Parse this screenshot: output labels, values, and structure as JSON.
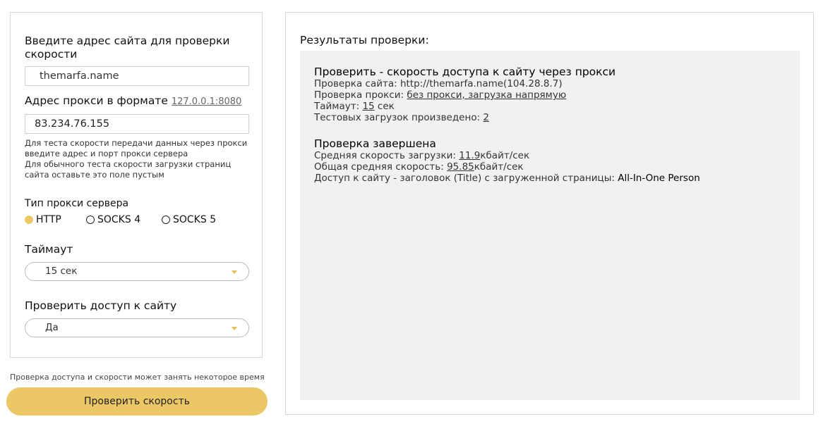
{
  "form": {
    "site_label": "Введите адрес сайта для проверки скорости",
    "site_value": "themarfa.name",
    "proxy_label": "Адрес прокси в формате",
    "proxy_example": "127.0.0.1:8080",
    "proxy_value": "83.234.76.155",
    "hint_lines": [
      "Для теста скорости передачи данных через прокси",
      "введите адрес и порт прокси сервера",
      "Для обычного теста скорости загрузки страниц",
      "сайта оставьте это поле пустым"
    ],
    "proxy_type_label": "Тип прокси сервера",
    "proxy_types": [
      {
        "label": "HTTP",
        "selected": true
      },
      {
        "label": "SOCKS 4",
        "selected": false
      },
      {
        "label": "SOCKS 5",
        "selected": false
      }
    ],
    "timeout_label": "Таймаут",
    "timeout_value": "15 сек",
    "access_label": "Проверить доступ к сайту",
    "access_value": "Да",
    "note": "Проверка доступа и скорости может занять некоторое время",
    "submit_label": "Проверить скорость"
  },
  "results": {
    "title": "Результаты проверки:",
    "block1": {
      "heading": "Проверить - скорость доступа к сайту через прокси",
      "site_line": "Проверка сайта: http://themarfa.name(104.28.8.7)",
      "proxy_prefix": "Проверка прокси: ",
      "proxy_value": "без прокси, загрузка напрямую",
      "timeout_prefix": "Таймаут: ",
      "timeout_value": "15",
      "timeout_suffix": " сек",
      "tests_prefix": "Тестовых загрузок произведено: ",
      "tests_value": "2"
    },
    "block2": {
      "heading": "Проверка завершена",
      "avg_prefix": "Средняя скорость загрузки: ",
      "avg_value": "11.9",
      "avg_suffix": "кбайт/сек",
      "total_prefix": "Общая средняя скорость: ",
      "total_value": "95.85",
      "total_suffix": "кбайт/сек",
      "title_prefix": "Доступ к сайту - заголовок (Title) с загруженной страницы: ",
      "title_value": "All-In-One Person"
    }
  },
  "colors": {
    "accent": "#ecc766",
    "border": "#d8d8d8",
    "results_bg": "#f1f1f1"
  }
}
